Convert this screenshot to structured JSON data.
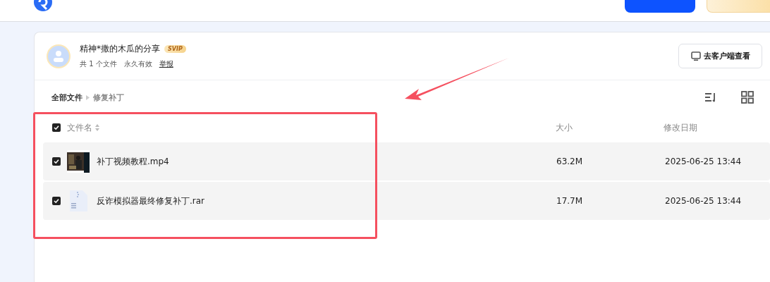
{
  "header": {
    "buttons": [
      {
        "kind": "primary"
      },
      {
        "kind": "vip"
      }
    ]
  },
  "share": {
    "title": "精神*撒的木瓜的分享",
    "badge": "SVIP",
    "file_count": "共 1 个文件",
    "validity": "永久有效",
    "report": "举报",
    "open_button": "去客户端查看"
  },
  "breadcrumb": [
    {
      "label": "全部文件",
      "current": false
    },
    {
      "label": "修复补丁",
      "current": true
    }
  ],
  "table": {
    "all_checked": true,
    "columns": [
      "文件名",
      "大小",
      "修改日期"
    ],
    "rows": [
      {
        "name": "补丁视频教程.mp4",
        "kind": "video",
        "size": "63.2M",
        "date": "2025-06-25 13:44",
        "checked": true
      },
      {
        "name": "反诈模拟器最终修复补丁.rar",
        "kind": "archive",
        "size": "17.7M",
        "date": "2025-06-25 13:44",
        "checked": true
      }
    ]
  },
  "annotation": {
    "color": "#f5505f"
  }
}
